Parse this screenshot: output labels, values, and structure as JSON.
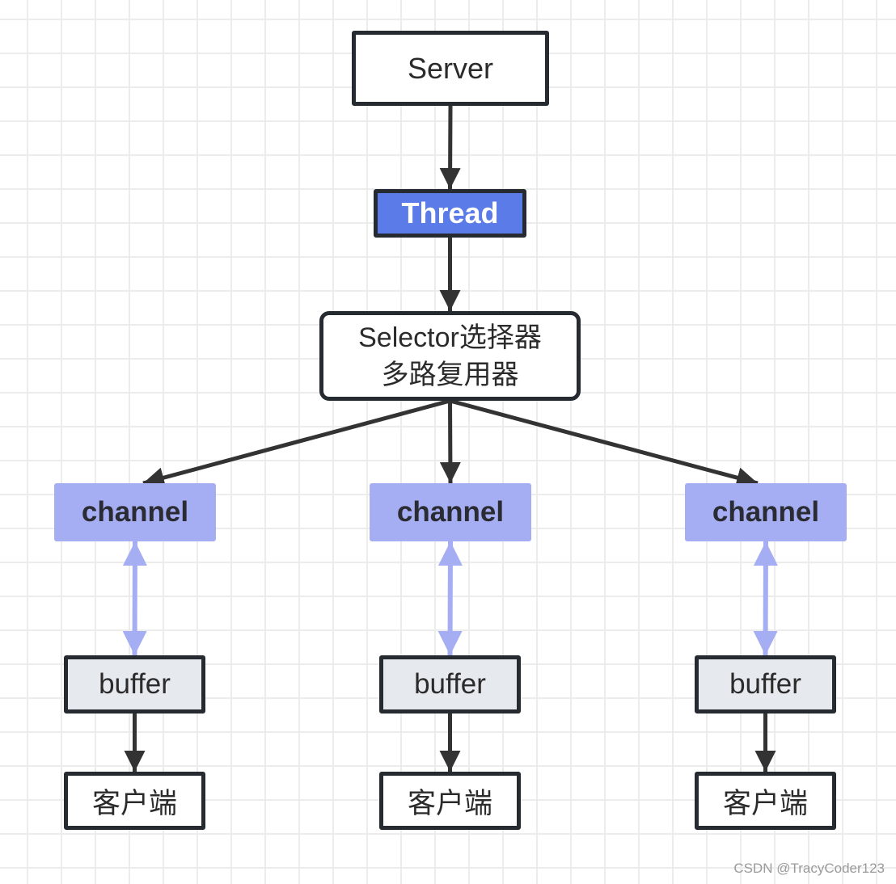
{
  "diagram": {
    "server": {
      "label": "Server"
    },
    "thread": {
      "label": "Thread",
      "fill": "#5b7be8"
    },
    "selector": {
      "line1": "Selector选择器",
      "line2": "多路复用器"
    },
    "channels": [
      {
        "label": "channel"
      },
      {
        "label": "channel"
      },
      {
        "label": "channel"
      }
    ],
    "buffers": [
      {
        "label": "buffer"
      },
      {
        "label": "buffer"
      },
      {
        "label": "buffer"
      }
    ],
    "clients": [
      {
        "label": "客户端"
      },
      {
        "label": "客户端"
      },
      {
        "label": "客户端"
      }
    ],
    "colors": {
      "stroke": "#262b31",
      "arrow": "#333333",
      "thread_fill": "#5b7be8",
      "channel_fill": "#a5aef2",
      "channel_link": "#a5aef2",
      "buffer_fill": "#e6e9ed",
      "grid": "#ececec"
    },
    "edges": [
      {
        "from": "server",
        "to": "thread",
        "type": "arrow"
      },
      {
        "from": "thread",
        "to": "selector",
        "type": "arrow"
      },
      {
        "from": "selector",
        "to": "channel-1",
        "type": "arrow"
      },
      {
        "from": "selector",
        "to": "channel-2",
        "type": "arrow"
      },
      {
        "from": "selector",
        "to": "channel-3",
        "type": "arrow"
      },
      {
        "from": "channel-1",
        "to": "buffer-1",
        "type": "bidirectional"
      },
      {
        "from": "channel-2",
        "to": "buffer-2",
        "type": "bidirectional"
      },
      {
        "from": "channel-3",
        "to": "buffer-3",
        "type": "bidirectional"
      },
      {
        "from": "buffer-1",
        "to": "client-1",
        "type": "arrow"
      },
      {
        "from": "buffer-2",
        "to": "client-2",
        "type": "arrow"
      },
      {
        "from": "buffer-3",
        "to": "client-3",
        "type": "arrow"
      }
    ]
  },
  "watermark": "CSDN @TracyCoder123"
}
